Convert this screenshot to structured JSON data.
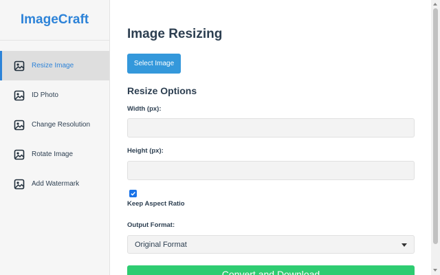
{
  "app": {
    "title": "ImageCraft",
    "accent": "#2d83d8"
  },
  "sidebar": {
    "items": [
      {
        "label": "Resize Image",
        "icon": "image-icon",
        "active": true
      },
      {
        "label": "ID Photo",
        "icon": "image-icon",
        "active": false
      },
      {
        "label": "Change Resolution",
        "icon": "image-icon",
        "active": false
      },
      {
        "label": "Rotate Image",
        "icon": "image-icon",
        "active": false
      },
      {
        "label": "Add Watermark",
        "icon": "image-icon",
        "active": false
      }
    ]
  },
  "main": {
    "title": "Image Resizing",
    "select_button": "Select Image",
    "options_title": "Resize Options",
    "width_label": "Width (px):",
    "width_value": "",
    "height_label": "Height (px):",
    "height_value": "",
    "aspect_label": "Keep Aspect Ratio",
    "aspect_checked": true,
    "format_label": "Output Format:",
    "format_value": "Original Format",
    "convert_button": "Convert and Download"
  },
  "colors": {
    "primary_button": "#3498db",
    "convert_button": "#2ecc71",
    "text": "#2c3e50"
  }
}
